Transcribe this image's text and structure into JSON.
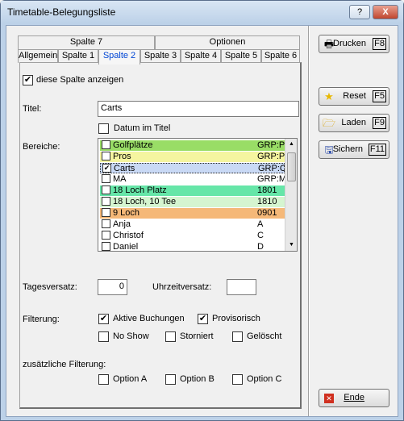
{
  "window": {
    "title": "Timetable-Belegungsliste"
  },
  "titlebar_buttons": {
    "help": "?",
    "close": "X"
  },
  "tabs_back": [
    "Spalte 7",
    "Optionen"
  ],
  "tabs_front": [
    "Allgemein",
    "Spalte 1",
    "Spalte 2",
    "Spalte 3",
    "Spalte 4",
    "Spalte 5",
    "Spalte 6"
  ],
  "active_tab": "Spalte 2",
  "panel": {
    "show_column": {
      "label": "diese Spalte anzeigen",
      "checked": true
    },
    "title_label": "Titel:",
    "title_value": "Carts",
    "date_in_title": {
      "label": "Datum im Titel",
      "checked": false
    },
    "areas_label": "Bereiche:",
    "areas": [
      {
        "name": "Golfplätze",
        "code": "GRP:Pl",
        "checked": false,
        "color": "#99dd66"
      },
      {
        "name": "Pros",
        "code": "GRP:Pr",
        "checked": false,
        "color": "#f5f5a0"
      },
      {
        "name": "Carts",
        "code": "GRP:Ca",
        "checked": true,
        "color": "#c9d9f5"
      },
      {
        "name": "MA",
        "code": "GRP:MA",
        "checked": false,
        "color": "#ffffff"
      },
      {
        "name": "18 Loch Platz",
        "code": "1801",
        "checked": false,
        "color": "#66e6a8"
      },
      {
        "name": "18 Loch, 10 Tee",
        "code": "1810",
        "checked": false,
        "color": "#d5f5d0"
      },
      {
        "name": "9 Loch",
        "code": "0901",
        "checked": false,
        "color": "#f5b878"
      },
      {
        "name": "Anja",
        "code": "A",
        "checked": false,
        "color": "#ffffff"
      },
      {
        "name": "Christof",
        "code": "C",
        "checked": false,
        "color": "#ffffff"
      },
      {
        "name": "Daniel",
        "code": "D",
        "checked": false,
        "color": "#ffffff"
      }
    ],
    "day_offset_label": "Tagesversatz:",
    "day_offset_value": "0",
    "time_offset_label": "Uhrzeitversatz:",
    "time_offset_value": "",
    "filter_label": "Filterung:",
    "filters": [
      {
        "label": "Aktive Buchungen",
        "checked": true
      },
      {
        "label": "Provisorisch",
        "checked": true
      },
      {
        "label": "No Show",
        "checked": false
      },
      {
        "label": "Storniert",
        "checked": false
      },
      {
        "label": "Gelöscht",
        "checked": false
      }
    ],
    "extra_filter_label": "zusätzliche Filterung:",
    "options": [
      {
        "label": "Option A",
        "checked": false
      },
      {
        "label": "Option B",
        "checked": false
      },
      {
        "label": "Option C",
        "checked": false
      }
    ]
  },
  "side_buttons": {
    "print": {
      "label": "Drucken",
      "key": "F8",
      "icon": "printer-icon"
    },
    "reset": {
      "label": "Reset",
      "key": "F5",
      "icon": "star-icon"
    },
    "load": {
      "label": "Laden",
      "key": "F9",
      "icon": "folder-icon"
    },
    "save": {
      "label": "Sichern",
      "key": "F11",
      "icon": "disk-icon"
    },
    "end": {
      "label": "Ende",
      "key": "",
      "icon": "close-icon"
    }
  }
}
